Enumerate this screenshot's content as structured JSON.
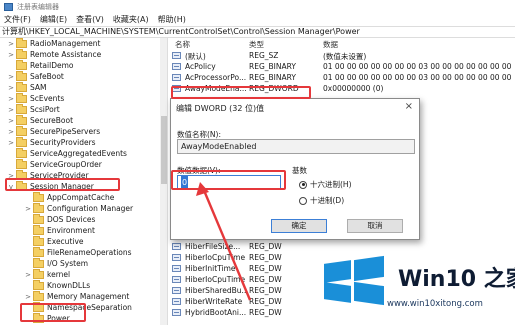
{
  "window": {
    "title": "注册表编辑器"
  },
  "menu": [
    "文件(F)",
    "编辑(E)",
    "查看(V)",
    "收藏夹(A)",
    "帮助(H)"
  ],
  "address": "计算机\\HKEY_LOCAL_MACHINE\\SYSTEM\\CurrentControlSet\\Control\\Session Manager\\Power",
  "tree": {
    "items": [
      {
        "label": "RadioManagement",
        "level": 0,
        "expand": ">"
      },
      {
        "label": "Remote Assistance",
        "level": 0,
        "expand": ">"
      },
      {
        "label": "RetailDemo",
        "level": 0,
        "expand": ""
      },
      {
        "label": "SafeBoot",
        "level": 0,
        "expand": ">"
      },
      {
        "label": "SAM",
        "level": 0,
        "expand": ">"
      },
      {
        "label": "ScEvents",
        "level": 0,
        "expand": ">"
      },
      {
        "label": "ScsiPort",
        "level": 0,
        "expand": ">"
      },
      {
        "label": "SecureBoot",
        "level": 0,
        "expand": ">"
      },
      {
        "label": "SecurePipeServers",
        "level": 0,
        "expand": ">"
      },
      {
        "label": "SecurityProviders",
        "level": 0,
        "expand": ">"
      },
      {
        "label": "ServiceAggregatedEvents",
        "level": 0,
        "expand": ""
      },
      {
        "label": "ServiceGroupOrder",
        "level": 0,
        "expand": ""
      },
      {
        "label": "ServiceProvider",
        "level": 0,
        "expand": ">"
      },
      {
        "label": "Session Manager",
        "level": 0,
        "expand": "v"
      },
      {
        "label": "AppCompatCache",
        "level": 1,
        "expand": ""
      },
      {
        "label": "Configuration Manager",
        "level": 1,
        "expand": ">"
      },
      {
        "label": "DOS Devices",
        "level": 1,
        "expand": ""
      },
      {
        "label": "Environment",
        "level": 1,
        "expand": ""
      },
      {
        "label": "Executive",
        "level": 1,
        "expand": ""
      },
      {
        "label": "FileRenameOperations",
        "level": 1,
        "expand": ""
      },
      {
        "label": "I/O System",
        "level": 1,
        "expand": ""
      },
      {
        "label": "kernel",
        "level": 1,
        "expand": ">"
      },
      {
        "label": "KnownDLLs",
        "level": 1,
        "expand": ""
      },
      {
        "label": "Memory Management",
        "level": 1,
        "expand": ">"
      },
      {
        "label": "NamespaceSeparation",
        "level": 1,
        "expand": ""
      },
      {
        "label": "Power",
        "level": 1,
        "expand": ""
      }
    ]
  },
  "list": {
    "headers": {
      "name": "名称",
      "type": "类型",
      "data": "数据"
    },
    "top_rows": [
      {
        "name": "(默认)",
        "type": "REG_SZ",
        "data": "(数值未设置)"
      },
      {
        "name": "AcPolicy",
        "type": "REG_BINARY",
        "data": "01 00 00 00 00 00 00 00 03 00 00 00 00 00 00 00"
      },
      {
        "name": "AcProcessorPo...",
        "type": "REG_BINARY",
        "data": "01 00 00 00 00 00 00 00 03 00 00 00 00 00 00 00"
      },
      {
        "name": "AwayModeEna...",
        "type": "REG_DWORD",
        "data": "0x00000000 (0)"
      }
    ],
    "bottom_rows": [
      {
        "name": "HiberFileSize...",
        "type": "REG_DW"
      },
      {
        "name": "HiberIoCpuTime",
        "type": "REG_DW"
      },
      {
        "name": "HiberInitTime",
        "type": "REG_DW"
      },
      {
        "name": "HiberIoCpuTime",
        "type": "REG_DW"
      },
      {
        "name": "HiberSharedBu...",
        "type": "REG_DW"
      },
      {
        "name": "HiberWriteRate",
        "type": "REG_DW"
      },
      {
        "name": "HybridBootAni...",
        "type": "REG_DW"
      }
    ]
  },
  "dialog": {
    "title": "编辑 DWORD (32 位)值",
    "close_glyph": "×",
    "name_label": "数值名称(N):",
    "name_value": "AwayModeEnabled",
    "data_label": "数值数据(V):",
    "data_value": "0",
    "base_label": "基数",
    "hex_label": "十六进制(H)",
    "dec_label": "十进制(D)",
    "base_selected": "hex",
    "ok_label": "确定",
    "cancel_label": "取消"
  },
  "annotations": {
    "highlight_color": "#e5383b"
  },
  "watermark": {
    "brand": "Win10 之家",
    "url": "www.win10xitong.com",
    "logo_color": "#1a8fd8"
  }
}
